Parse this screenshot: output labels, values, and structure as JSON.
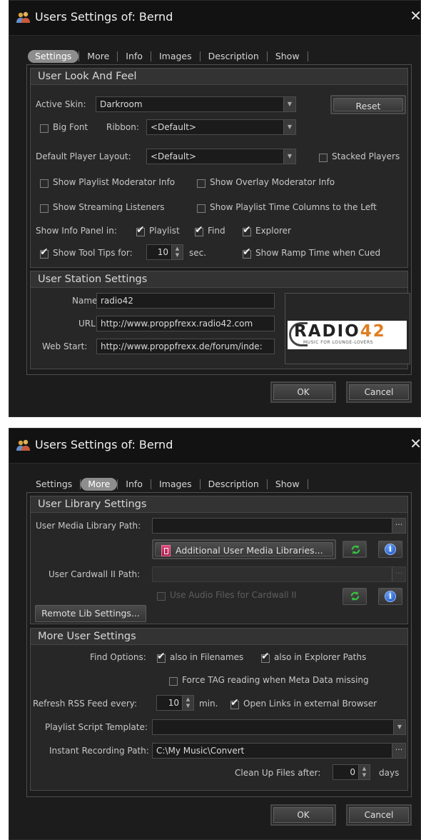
{
  "windows": [
    {
      "title": "Users Settings of: Bernd",
      "tabs": [
        "Settings",
        "More",
        "Info",
        "Images",
        "Description",
        "Show"
      ],
      "selected_tab": "Settings",
      "look_group": {
        "title": "User Look And Feel",
        "active_skin_label": "Active Skin:",
        "active_skin_value": "Darkroom",
        "reset_label": "Reset",
        "big_font_label": "Big Font",
        "big_font_checked": false,
        "ribbon_label": "Ribbon:",
        "ribbon_value": "<Default>",
        "player_layout_label": "Default Player Layout:",
        "player_layout_value": "<Default>",
        "stacked_players_label": "Stacked Players",
        "stacked_players_checked": false,
        "show_playlist_mod_label": "Show Playlist Moderator Info",
        "show_overlay_mod_label": "Show Overlay Moderator Info",
        "show_streaming_label": "Show Streaming Listeners",
        "show_time_columns_label": "Show Playlist Time Columns to the Left",
        "info_panel_label": "Show Info Panel in:",
        "playlist_label": "Playlist",
        "find_label": "Find",
        "explorer_label": "Explorer",
        "tooltips_label": "Show Tool Tips for:",
        "tooltips_value": "10",
        "tooltips_unit": "sec.",
        "ramp_time_label": "Show Ramp Time when Cued"
      },
      "station_group": {
        "title": "User Station Settings",
        "name_label": "Name:",
        "name_value": "radio42",
        "url_label": "URL:",
        "url_value": "http://www.proppfrexx.radio42.com",
        "webstart_label": "Web Start:",
        "webstart_value": "http://www.proppfrexx.de/forum/inde:",
        "logo_text": "RADIO",
        "logo_number": "42",
        "logo_tagline": "MUSIC FOR LOUNGE-LOVERS"
      },
      "ok_label": "OK",
      "cancel_label": "Cancel"
    },
    {
      "title": "Users Settings of: Bernd",
      "tabs": [
        "Settings",
        "More",
        "Info",
        "Images",
        "Description",
        "Show"
      ],
      "selected_tab": "More",
      "library_group": {
        "title": "User Library Settings",
        "media_path_label": "User Media Library Path:",
        "media_path_value": "",
        "additional_libraries_label": "Additional User Media Libraries...",
        "cardwall_path_label": "User Cardwall II Path:",
        "cardwall_path_value": "",
        "use_audio_label": "Use Audio Files for Cardwall II",
        "remote_lib_label": "Remote Lib Settings..."
      },
      "more_group": {
        "title": "More User Settings",
        "find_options_label": "Find Options:",
        "also_filenames_label": "also in Filenames",
        "also_explorer_label": "also in Explorer Paths",
        "force_tag_label": "Force TAG reading when Meta Data missing",
        "rss_label": "Refresh RSS Feed every:",
        "rss_value": "10",
        "rss_unit": "min.",
        "open_links_label": "Open Links in external Browser",
        "script_template_label": "Playlist Script Template:",
        "script_template_value": "",
        "recording_path_label": "Instant Recording Path:",
        "recording_path_value": "C:\\My Music\\Convert",
        "cleanup_label": "Clean Up Files after:",
        "cleanup_value": "0",
        "cleanup_unit": "days"
      },
      "ok_label": "OK",
      "cancel_label": "Cancel"
    }
  ],
  "colors": {
    "window_bg": "#1c1c1c",
    "titlebar_bg": "#121212",
    "group_bg": "#272727",
    "selected_tab_bg": "#8d8d8d",
    "logo_accent": "#e07d22"
  }
}
